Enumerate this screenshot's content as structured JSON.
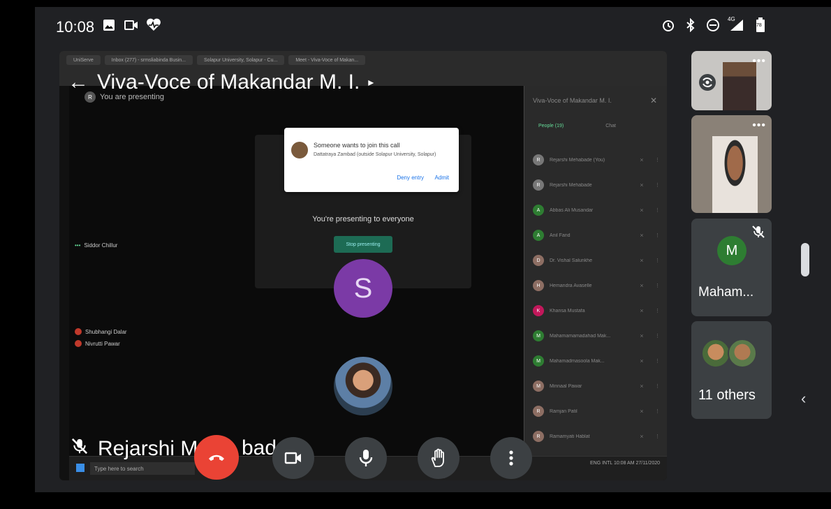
{
  "status": {
    "time": "10:08",
    "left_icons": [
      "image-icon",
      "video-record-icon",
      "heart-health-icon"
    ],
    "right_icons": [
      "alarm-icon",
      "bluetooth-icon",
      "do-not-disturb-icon",
      "signal-icon",
      "battery-icon"
    ],
    "signal_label": "4G",
    "battery_level": "78"
  },
  "call": {
    "title": "Viva-Voce of Makandar M. I.",
    "pinned_name": "Rejarshi M",
    "pinned_name_suffix": "bad"
  },
  "browser": {
    "tabs": [
      "UniServe",
      "Inbox (277) - srmsliabinda Busin...",
      "Solapur University, Solapur - Cu...",
      "Meet - Viva-Voce of Makan..."
    ]
  },
  "shared_screen": {
    "presenting_label": "You are presenting",
    "presenting_msg": "You're presenting to everyone",
    "stop_label": "Stop presenting",
    "notification": {
      "title": "Someone wants to join this call",
      "subtitle": "Dattatraya Zambad (outside Solapur University, Solapur)",
      "deny": "Deny entry",
      "admit": "Admit"
    },
    "tile_names": [
      "Siddor Chillur",
      "Shubhangi Dalar",
      "Nivrutti Pawar"
    ],
    "center_avatar_letter": "S",
    "panel": {
      "title": "Viva-Voce of Makandar M. I.",
      "tab_people": "People (19)",
      "tab_chat": "Chat",
      "participants": [
        {
          "name": "Rejarshi Mehabade (You)",
          "initial": "R",
          "color": "#777777"
        },
        {
          "name": "Rejarshi Mehabade",
          "initial": "R",
          "color": "#777777"
        },
        {
          "name": "Abbas Ali Musandar",
          "initial": "A",
          "color": "#2e7d32"
        },
        {
          "name": "Anil Fand",
          "initial": "A",
          "color": "#2e7d32"
        },
        {
          "name": "Dr. Vishal Salunkhe",
          "initial": "D",
          "color": "#8d6e63"
        },
        {
          "name": "Hemandra Avaselle",
          "initial": "H",
          "color": "#8d6e63"
        },
        {
          "name": "Khansa Mustafa",
          "initial": "K",
          "color": "#c2185b"
        },
        {
          "name": "Mahamamamadahad Mak...",
          "initial": "M",
          "color": "#2e7d32"
        },
        {
          "name": "Mahamadmasoola Mak...",
          "initial": "M",
          "color": "#2e7d32"
        },
        {
          "name": "Minnaal Pawar",
          "initial": "M",
          "color": "#8d6e63"
        },
        {
          "name": "Ramjan Patil",
          "initial": "R",
          "color": "#8d6e63"
        },
        {
          "name": "Ramamyati Hablat",
          "initial": "R",
          "color": "#8d6e63"
        }
      ]
    },
    "taskbar": {
      "search_placeholder": "Type here to search",
      "tray_lang": "ENG INTL",
      "tray_time": "10:08 AM",
      "tray_date": "27/11/2020"
    }
  },
  "side_tiles": {
    "tile3_letter": "M",
    "tile3_name": "Maham...",
    "tile4_name": "11 others"
  },
  "colors": {
    "background": "#202124",
    "end_call": "#ea4335",
    "control": "#3c4043"
  }
}
